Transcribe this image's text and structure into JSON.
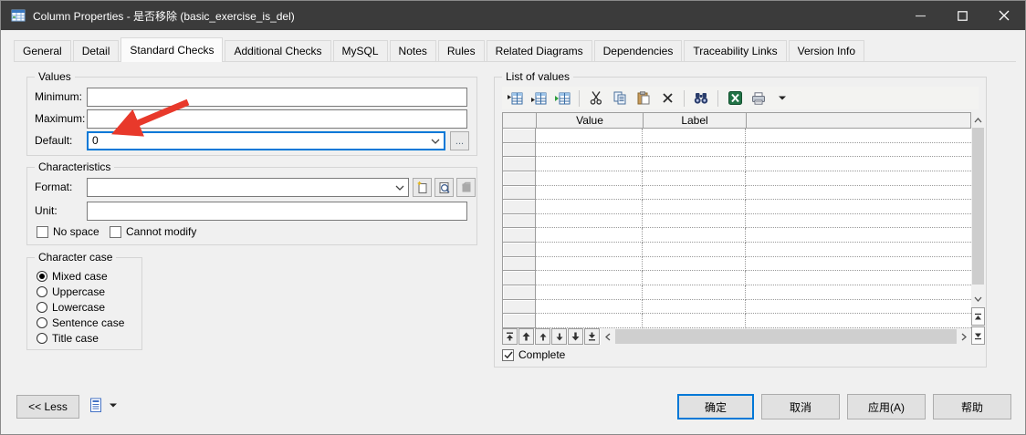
{
  "window": {
    "title": "Column Properties - 是否移除 (basic_exercise_is_del)",
    "controls": [
      "minimize",
      "maximize",
      "close"
    ]
  },
  "tabs": [
    {
      "label": "General",
      "active": false
    },
    {
      "label": "Detail",
      "active": false
    },
    {
      "label": "Standard Checks",
      "active": true
    },
    {
      "label": "Additional Checks",
      "active": false
    },
    {
      "label": "MySQL",
      "active": false
    },
    {
      "label": "Notes",
      "active": false
    },
    {
      "label": "Rules",
      "active": false
    },
    {
      "label": "Related Diagrams",
      "active": false
    },
    {
      "label": "Dependencies",
      "active": false
    },
    {
      "label": "Traceability Links",
      "active": false
    },
    {
      "label": "Version Info",
      "active": false
    }
  ],
  "values_group": {
    "title": "Values",
    "minimum_label": "Minimum:",
    "minimum_value": "",
    "maximum_label": "Maximum:",
    "maximum_value": "",
    "default_label": "Default:",
    "default_value": "0",
    "browse_label": "..."
  },
  "characteristics_group": {
    "title": "Characteristics",
    "format_label": "Format:",
    "format_value": "",
    "unit_label": "Unit:",
    "unit_value": "",
    "no_space_label": "No space",
    "no_space_checked": false,
    "cannot_modify_label": "Cannot modify",
    "cannot_modify_checked": false,
    "format_buttons": [
      "new-format-icon",
      "preview-format-icon",
      "properties-disabled-icon"
    ]
  },
  "character_case_group": {
    "title": "Character case",
    "options": [
      {
        "label": "Mixed case",
        "selected": true
      },
      {
        "label": "Uppercase",
        "selected": false
      },
      {
        "label": "Lowercase",
        "selected": false
      },
      {
        "label": "Sentence case",
        "selected": false
      },
      {
        "label": "Title case",
        "selected": false
      }
    ]
  },
  "list_of_values": {
    "title": "List of values",
    "toolbar_icons": [
      "insert-row-icon",
      "add-row-icon",
      "append-rows-icon",
      "cut-icon",
      "copy-icon",
      "paste-icon",
      "delete-icon",
      "find-icon",
      "excel-export-icon",
      "print-icon",
      "dropdown-caret-icon"
    ],
    "grid": {
      "columns": [
        "",
        "Value",
        "Label",
        ""
      ],
      "row_count": 14,
      "rows_empty": true
    },
    "move_buttons": [
      "move-to-top",
      "move-up-many",
      "move-up",
      "move-down",
      "move-down-many",
      "move-to-bottom"
    ],
    "complete_label": "Complete",
    "complete_checked": true
  },
  "footer": {
    "less_label": "<< Less",
    "report_tool": "report-preview-icon",
    "ok_label": "确定",
    "cancel_label": "取消",
    "apply_label": "应用(A)",
    "help_label": "帮助"
  },
  "annotation": {
    "type": "red-arrow",
    "color": "#e8392b",
    "points_at": "default-field"
  },
  "colors": {
    "titlebar": "#3b3b3b",
    "dialog_bg": "#f0f0f0",
    "accent": "#0078d7",
    "focus_border": "#0078d7"
  }
}
